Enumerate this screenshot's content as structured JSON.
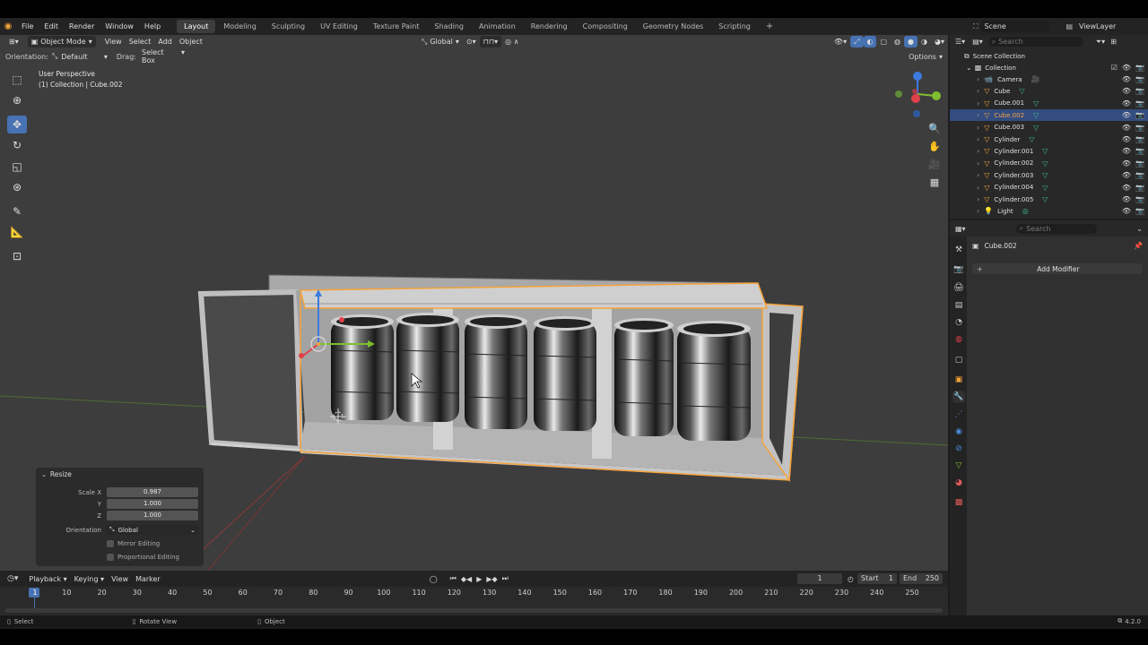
{
  "menu": {
    "items": [
      "File",
      "Edit",
      "Render",
      "Window",
      "Help"
    ],
    "workspaces": [
      "Layout",
      "Modeling",
      "Sculpting",
      "UV Editing",
      "Texture Paint",
      "Shading",
      "Animation",
      "Rendering",
      "Compositing",
      "Geometry Nodes",
      "Scripting"
    ],
    "active_workspace": "Layout",
    "add_tab": "+",
    "scene": "Scene",
    "view_layer": "ViewLayer"
  },
  "viewport": {
    "mode": "Object Mode",
    "menus": [
      "View",
      "Select",
      "Add",
      "Object"
    ],
    "transform_orientation": "Global",
    "orientation_label": "Orientation:",
    "orientation_value": "Default",
    "drag_label": "Drag:",
    "drag_value": "Select Box",
    "options": "Options",
    "view_name": "User Perspective",
    "object_info": "(1) Collection | Cube.002"
  },
  "redo_panel": {
    "title": "Resize",
    "scale_label": "Scale X",
    "scale_x": "0.987",
    "y_label": "Y",
    "scale_y": "1.000",
    "z_label": "Z",
    "scale_z": "1.000",
    "orientation_label": "Orientation",
    "orientation_value": "Global",
    "mirror": "Mirror Editing",
    "proportional": "Proportional Editing"
  },
  "timeline": {
    "menus": [
      "Playback",
      "Keying",
      "View",
      "Marker"
    ],
    "current_frame": "1",
    "start_label": "Start",
    "start": "1",
    "end_label": "End",
    "end": "250",
    "ticks": [
      "1",
      "10",
      "20",
      "30",
      "40",
      "50",
      "60",
      "70",
      "80",
      "90",
      "100",
      "110",
      "120",
      "130",
      "140",
      "150",
      "160",
      "170",
      "180",
      "190",
      "200",
      "210",
      "220",
      "230",
      "240",
      "250"
    ]
  },
  "statusbar": {
    "select": "Select",
    "rotate": "Rotate View",
    "object": "Object",
    "version": "4.2.0"
  },
  "outliner": {
    "search_placeholder": "Search",
    "scene_collection": "Scene Collection",
    "collection": "Collection",
    "items": [
      {
        "name": "Camera",
        "type": "camera",
        "selected": false
      },
      {
        "name": "Cube",
        "type": "mesh",
        "selected": false
      },
      {
        "name": "Cube.001",
        "type": "mesh",
        "selected": false
      },
      {
        "name": "Cube.002",
        "type": "mesh",
        "selected": true
      },
      {
        "name": "Cube.003",
        "type": "mesh",
        "selected": false
      },
      {
        "name": "Cylinder",
        "type": "mesh",
        "selected": false
      },
      {
        "name": "Cylinder.001",
        "type": "mesh",
        "selected": false
      },
      {
        "name": "Cylinder.002",
        "type": "mesh",
        "selected": false
      },
      {
        "name": "Cylinder.003",
        "type": "mesh",
        "selected": false
      },
      {
        "name": "Cylinder.004",
        "type": "mesh",
        "selected": false
      },
      {
        "name": "Cylinder.005",
        "type": "mesh",
        "selected": false
      },
      {
        "name": "Light",
        "type": "light",
        "selected": false
      }
    ]
  },
  "properties": {
    "search_placeholder": "Search",
    "object_name": "Cube.002",
    "add_modifier": "Add Modifier"
  },
  "colors": {
    "accent": "#4772b3",
    "selection_outline": "#f5a33a",
    "x_axis": "#e0404a",
    "y_axis": "#7fbf2f",
    "z_axis": "#3d7ae0"
  }
}
